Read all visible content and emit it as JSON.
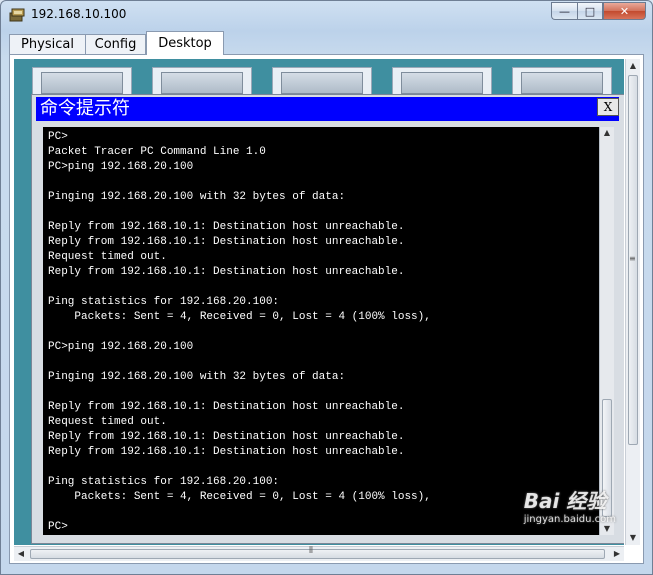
{
  "window": {
    "title": "192.168.10.100",
    "minimize_glyph": "—",
    "maximize_glyph": "□",
    "close_glyph": "✕"
  },
  "tabs": [
    {
      "label": "Physical"
    },
    {
      "label": "Config"
    },
    {
      "label": "Desktop",
      "active": true
    }
  ],
  "command_prompt": {
    "title": "命令提示符",
    "close_label": "X",
    "lines": [
      "PC>",
      "Packet Tracer PC Command Line 1.0",
      "PC>ping 192.168.20.100",
      "",
      "Pinging 192.168.20.100 with 32 bytes of data:",
      "",
      "Reply from 192.168.10.1: Destination host unreachable.",
      "Reply from 192.168.10.1: Destination host unreachable.",
      "Request timed out.",
      "Reply from 192.168.10.1: Destination host unreachable.",
      "",
      "Ping statistics for 192.168.20.100:",
      "    Packets: Sent = 4, Received = 0, Lost = 4 (100% loss),",
      "",
      "PC>ping 192.168.20.100",
      "",
      "Pinging 192.168.20.100 with 32 bytes of data:",
      "",
      "Reply from 192.168.10.1: Destination host unreachable.",
      "Request timed out.",
      "Reply from 192.168.10.1: Destination host unreachable.",
      "Reply from 192.168.10.1: Destination host unreachable.",
      "",
      "Ping statistics for 192.168.20.100:",
      "    Packets: Sent = 4, Received = 0, Lost = 4 (100% loss),",
      "",
      "PC>"
    ]
  },
  "watermark": {
    "brand": "Bai 经验",
    "url": "jingyan.baidu.com"
  },
  "colors": {
    "cmd_title_bg": "#0000ff",
    "terminal_bg": "#000000",
    "terminal_fg": "#ffffff",
    "desktop_bg": "#3f8fa0"
  }
}
